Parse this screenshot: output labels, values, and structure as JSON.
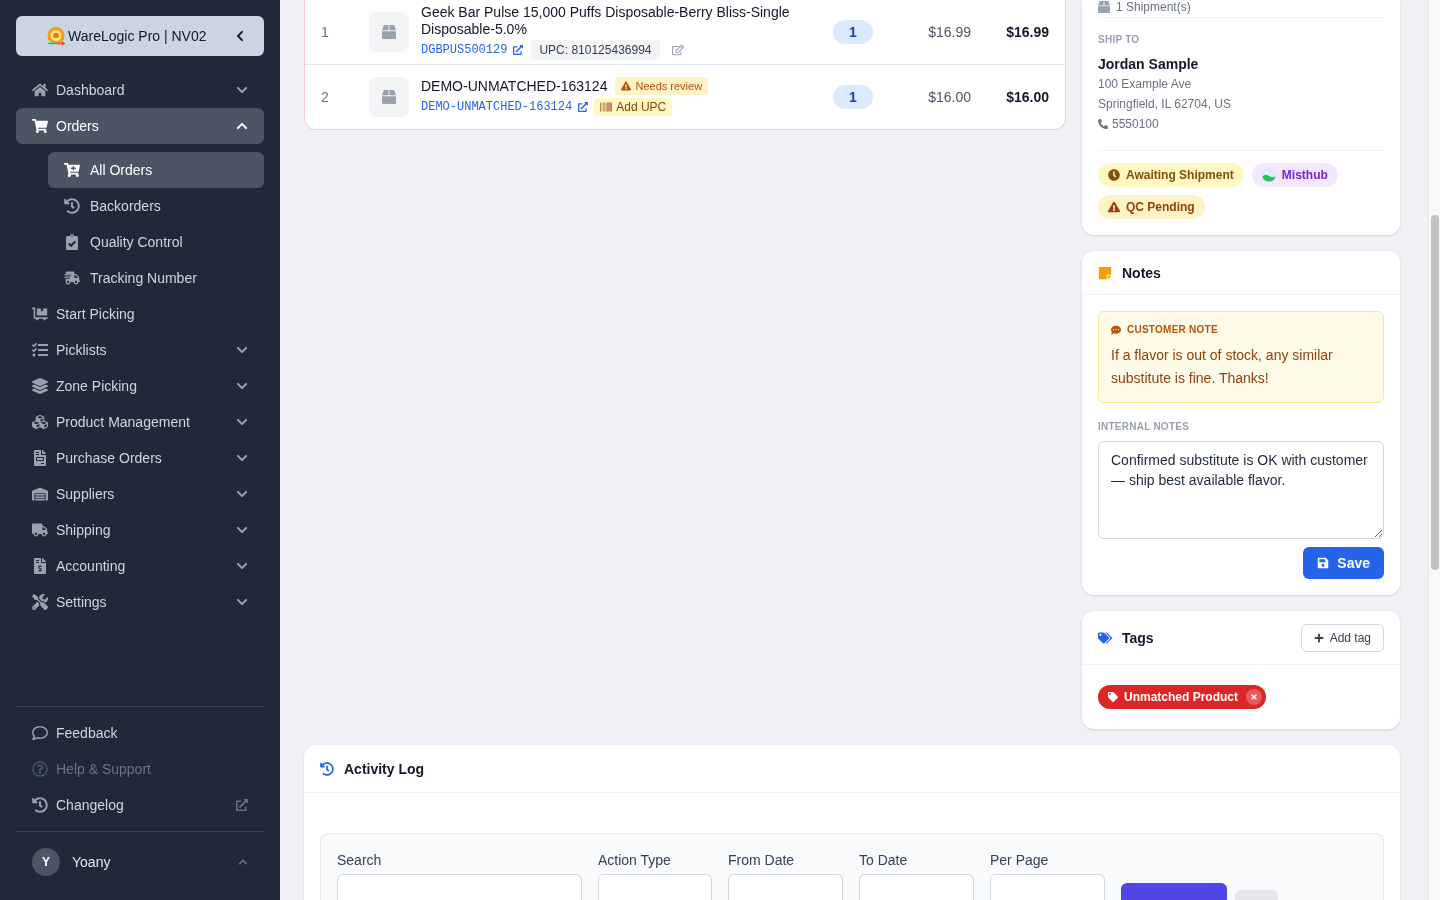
{
  "sidebar": {
    "brand": {
      "title": "WareLogic Pro | NV02"
    },
    "items": [
      {
        "label": "Dashboard",
        "selected": false,
        "expanded": false
      },
      {
        "label": "Orders",
        "selected": true,
        "expanded": true,
        "children": [
          {
            "label": "All Orders",
            "selected": true
          },
          {
            "label": "Backorders",
            "selected": false
          },
          {
            "label": "Quality Control",
            "selected": false
          },
          {
            "label": "Tracking Number",
            "selected": false
          }
        ]
      },
      {
        "label": "Start Picking",
        "selected": false
      },
      {
        "label": "Picklists",
        "selected": false,
        "expanded": false
      },
      {
        "label": "Zone Picking",
        "selected": false,
        "expanded": false
      },
      {
        "label": "Product Management",
        "selected": false,
        "expanded": false
      },
      {
        "label": "Purchase Orders",
        "selected": false,
        "expanded": false
      },
      {
        "label": "Suppliers",
        "selected": false,
        "expanded": false
      },
      {
        "label": "Shipping",
        "selected": false,
        "expanded": false
      },
      {
        "label": "Accounting",
        "selected": false,
        "expanded": false
      },
      {
        "label": "Settings",
        "selected": false,
        "expanded": false
      }
    ],
    "footer_links": [
      {
        "label": "Feedback",
        "disabled": false,
        "external": false
      },
      {
        "label": "Help & Support",
        "disabled": true,
        "external": false
      },
      {
        "label": "Changelog",
        "disabled": false,
        "external": true
      }
    ],
    "user": {
      "initial": "Y",
      "name": "Yoany"
    }
  },
  "order_items": {
    "rows": [
      {
        "index": "1",
        "name": "Geek Bar Pulse 15,000 Puffs Disposable-Berry Bliss-Single Disposable-5.0%",
        "sku": "DGBPUS500129",
        "upc": "UPC: 810125436994",
        "quantity": "1",
        "price": "$16.99",
        "total": "$16.99"
      },
      {
        "index": "2",
        "name": "DEMO-UNMATCHED-163124",
        "review_badge": "Needs review",
        "sku": "DEMO-UNMATCHED-163124",
        "add_upc_button": "Add UPC",
        "quantity": "1",
        "price": "$16.00",
        "total": "$16.00"
      }
    ]
  },
  "shipping_card": {
    "shipments": "1 Shipment(s)",
    "ship_to_label": "SHIP TO",
    "name": "Jordan Sample",
    "address_lines": [
      "100 Example Ave",
      "Springfield, IL 62704, US"
    ],
    "phone": "5550100",
    "badges": [
      {
        "label": "Awaiting Shipment",
        "kind": "status"
      },
      {
        "label": "Misthub",
        "kind": "channel"
      },
      {
        "label": "QC Pending",
        "kind": "warning"
      }
    ]
  },
  "notes": {
    "title": "Notes",
    "customer_note": {
      "label": "CUSTOMER NOTE",
      "text": "If a flavor is out of stock, any similar substitute is fine. Thanks!"
    },
    "internal_notes": {
      "label": "INTERNAL NOTES",
      "value": "Confirmed substitute is OK with customer — ship best available flavor."
    },
    "save_button": "Save"
  },
  "tags": {
    "title": "Tags",
    "add_button": "Add tag",
    "items": [
      {
        "label": "Unmatched Product",
        "color": "#dc2626"
      }
    ]
  },
  "activity_log": {
    "title": "Activity Log",
    "filters": [
      {
        "label": "Search"
      },
      {
        "label": "Action Type"
      },
      {
        "label": "From Date"
      },
      {
        "label": "To Date"
      },
      {
        "label": "Per Page"
      }
    ]
  }
}
